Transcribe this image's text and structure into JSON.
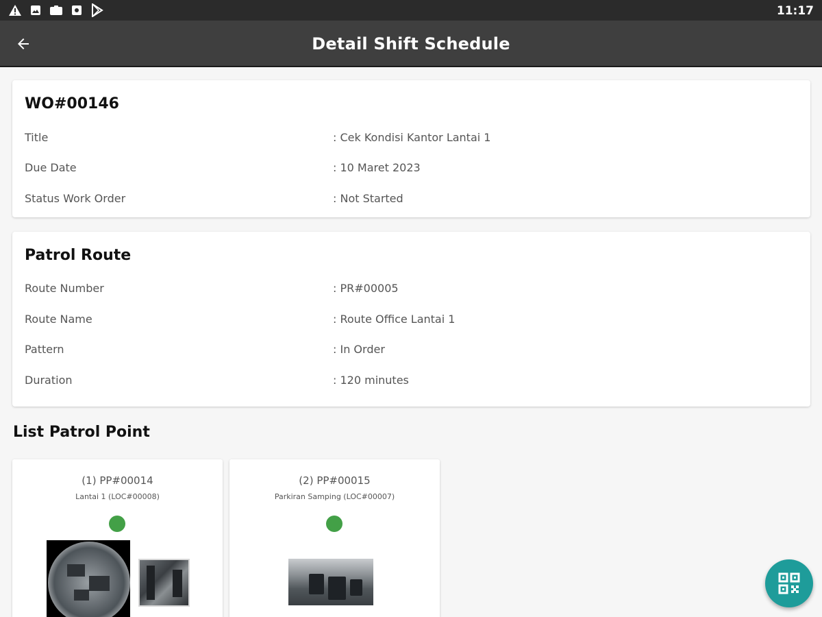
{
  "status_bar": {
    "time": "11:17",
    "icons": [
      "warning-icon",
      "image-icon",
      "briefcase-icon",
      "photo-icon",
      "play-store-icon"
    ]
  },
  "app_bar": {
    "title": "Detail Shift Schedule",
    "back_icon": "arrow-back-icon"
  },
  "work_order": {
    "number": "WO#00146",
    "rows": [
      {
        "label": "Title",
        "value": ": Cek Kondisi Kantor Lantai 1"
      },
      {
        "label": "Due Date",
        "value": ": 10 Maret 2023"
      },
      {
        "label": "Status Work Order",
        "value": ": Not Started"
      }
    ]
  },
  "patrol_route": {
    "heading": "Patrol Route",
    "rows": [
      {
        "label": "Route Number",
        "value": ": PR#00005"
      },
      {
        "label": "Route Name",
        "value": ": Route Office Lantai 1"
      },
      {
        "label": "Pattern",
        "value": ": In Order"
      },
      {
        "label": "Duration",
        "value": ": 120 minutes"
      }
    ]
  },
  "patrol_points": {
    "heading": "List Patrol Point",
    "status_color": "#43a047",
    "items": [
      {
        "code": "(1) PP#00014",
        "location": "Lantai 1 (LOC#00008)"
      },
      {
        "code": "(2) PP#00015",
        "location": "Parkiran Samping (LOC#00007)"
      }
    ]
  },
  "fab": {
    "icon": "qr-code-icon",
    "color": "#1e9c9a"
  }
}
